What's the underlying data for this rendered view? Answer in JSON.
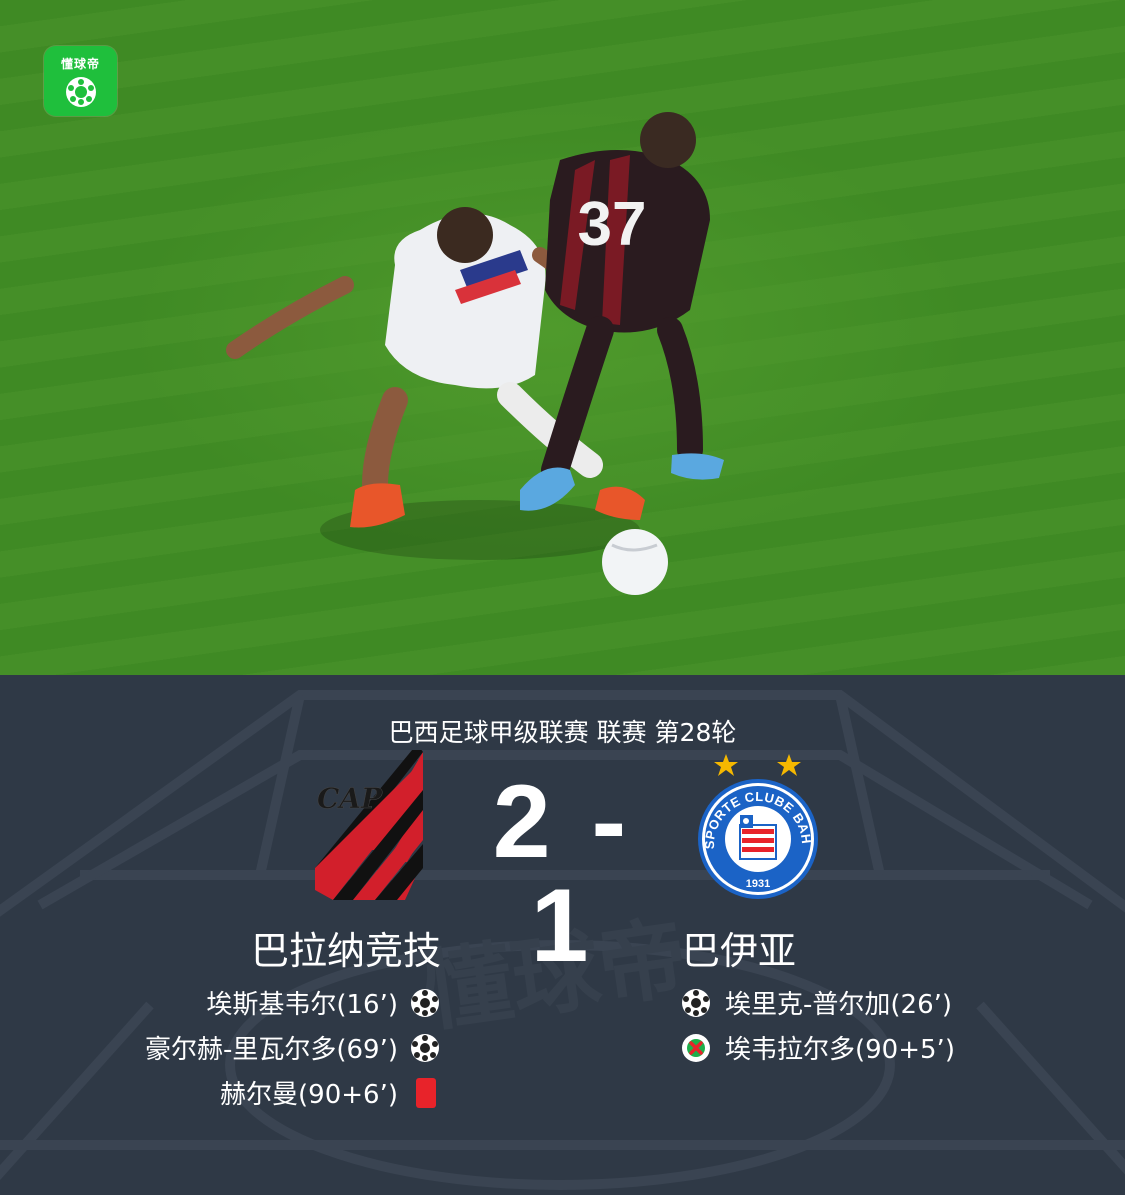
{
  "app": {
    "logo_text": "懂球帝"
  },
  "match": {
    "competition": "巴西足球甲级联赛 联赛 第28轮",
    "home_score": "2",
    "separator": "-",
    "away_score": "1"
  },
  "home": {
    "name": "巴拉纳竞技",
    "events": [
      {
        "text": "埃斯基韦尔(16’)",
        "type": "goal"
      },
      {
        "text": "豪尔赫-里瓦尔多(69’)",
        "type": "goal"
      },
      {
        "text": "赫尔曼(90+6’)",
        "type": "red-card"
      }
    ]
  },
  "away": {
    "name": "巴伊亚",
    "crest_ring_text": "ESPORTE CLUBE BAHIA",
    "crest_year": "1931",
    "events": [
      {
        "text": "埃里克-普尔加(26’)",
        "type": "goal"
      },
      {
        "text": "埃韦拉尔多(90+5’)",
        "type": "own-goal"
      }
    ]
  },
  "colors": {
    "background": "#2f3946",
    "home_red": "#d21f2b",
    "away_blue": "#1b63c6",
    "red_card": "#e8232a",
    "star": "#f5b800",
    "app_green": "#1fbf3c"
  },
  "photo": {
    "player_number": "37"
  }
}
